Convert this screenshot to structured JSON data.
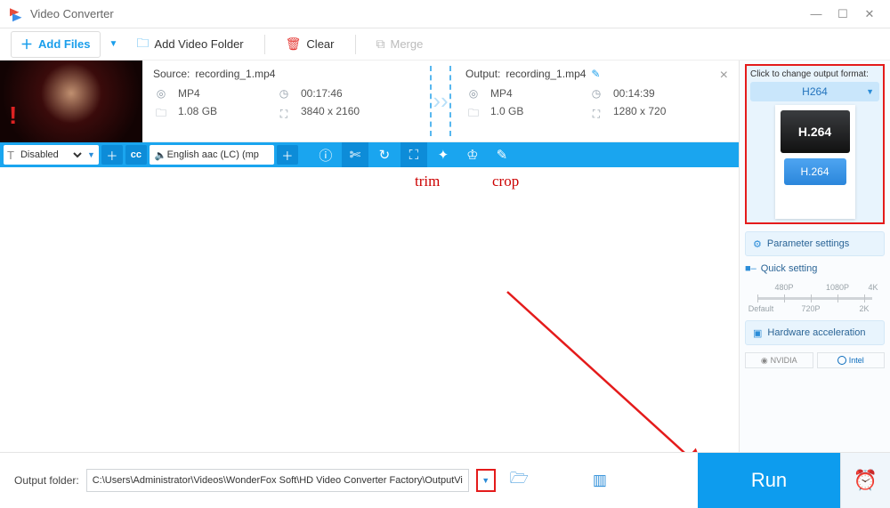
{
  "app": {
    "title": "Video Converter"
  },
  "toolbar": {
    "add_files": "Add Files",
    "add_folder": "Add Video Folder",
    "clear": "Clear",
    "merge": "Merge"
  },
  "item": {
    "source": {
      "label": "Source:",
      "filename": "recording_1.mp4",
      "format": "MP4",
      "duration": "00:17:46",
      "size": "1.08 GB",
      "resolution": "3840 x 2160"
    },
    "output": {
      "label": "Output:",
      "filename": "recording_1.mp4",
      "format": "MP4",
      "duration": "00:14:39",
      "size": "1.0 GB",
      "resolution": "1280 x 720"
    },
    "subtitle_mode": "Disabled",
    "audio_track": "English aac (LC) (mp"
  },
  "annotations": {
    "trim": "trim",
    "crop": "crop"
  },
  "side": {
    "change_hint": "Click to change output format:",
    "pill_label": "H264",
    "card_top": "H.264",
    "card_bot": "H.264",
    "parameter_btn": "Parameter settings",
    "quick_setting_label": "Quick setting",
    "ticks_top": [
      "480P",
      "1080P",
      "4K"
    ],
    "ticks_bot": [
      "Default",
      "720P",
      "2K"
    ],
    "hw_btn": "Hardware acceleration",
    "nvidia": "NVIDIA",
    "intel": "Intel"
  },
  "footer": {
    "label": "Output folder:",
    "path": "C:\\Users\\Administrator\\Videos\\WonderFox Soft\\HD Video Converter Factory\\OutputVideo\\",
    "run": "Run"
  }
}
